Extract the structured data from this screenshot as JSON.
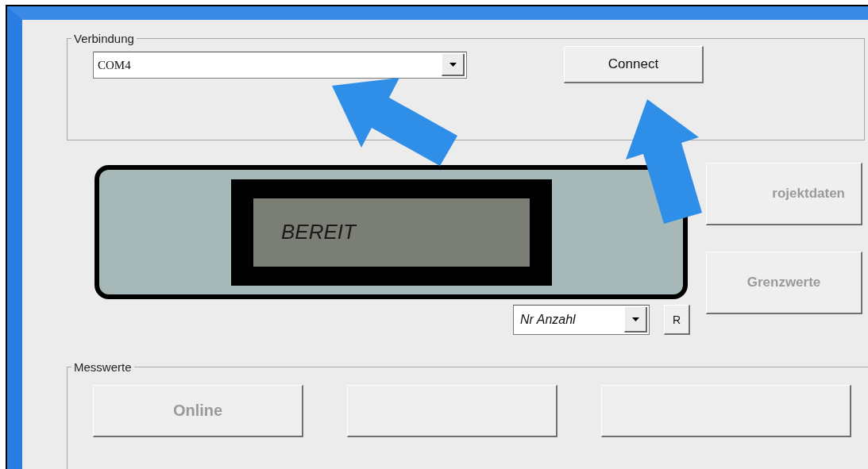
{
  "verbindung": {
    "title": "Verbindung",
    "port": {
      "value": "COM4"
    },
    "connect": {
      "label": "Connect",
      "disabled": false
    }
  },
  "display": {
    "text": "BEREIT"
  },
  "side_buttons": [
    {
      "label": "rojektdaten",
      "disabled": true
    },
    {
      "label": "Grenzwerte",
      "disabled": true
    }
  ],
  "mode_select": {
    "value": "Nr Anzahl"
  },
  "reset": {
    "label": "R",
    "disabled": false
  },
  "messwerte": {
    "title": "Messwerte",
    "buttons": [
      {
        "kind": "text",
        "label": "Online",
        "disabled": true
      },
      {
        "kind": "blank"
      },
      {
        "kind": "blank"
      }
    ]
  }
}
